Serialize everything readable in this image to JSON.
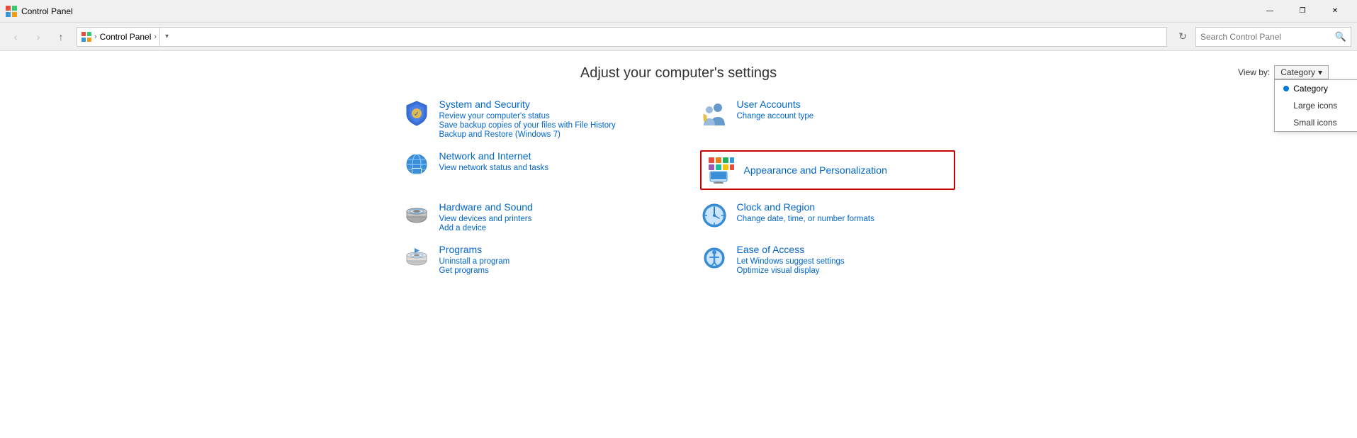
{
  "window": {
    "title": "Control Panel",
    "icon": "control-panel-icon"
  },
  "titlebar": {
    "minimize_label": "—",
    "restore_label": "❐",
    "close_label": "✕"
  },
  "navbar": {
    "back_label": "‹",
    "forward_label": "›",
    "up_label": "↑",
    "address": "Control Panel",
    "breadcrumb_root": "⊞",
    "breadcrumb_sep": "›",
    "refresh_label": "↻",
    "down_label": "▾",
    "search_placeholder": "Search Control Panel",
    "search_icon": "🔍"
  },
  "main": {
    "page_title": "Adjust your computer's settings",
    "viewby_label": "View by:",
    "viewby_current": "Category",
    "viewby_options": [
      {
        "id": "category",
        "label": "Category",
        "selected": true
      },
      {
        "id": "large-icons",
        "label": "Large icons",
        "selected": false
      },
      {
        "id": "small-icons",
        "label": "Small icons",
        "selected": false
      }
    ]
  },
  "categories": [
    {
      "id": "system-security",
      "title": "System and Security",
      "links": [
        "Review your computer's status",
        "Save backup copies of your files with File History",
        "Backup and Restore (Windows 7)"
      ]
    },
    {
      "id": "user-accounts",
      "title": "User Accounts",
      "links": [
        "Change account type"
      ]
    },
    {
      "id": "network-internet",
      "title": "Network and Internet",
      "links": [
        "View network status and tasks"
      ]
    },
    {
      "id": "appearance",
      "title": "Appearance and Personalization",
      "links": [],
      "highlighted": true
    },
    {
      "id": "hardware-sound",
      "title": "Hardware and Sound",
      "links": [
        "View devices and printers",
        "Add a device"
      ]
    },
    {
      "id": "clock-region",
      "title": "Clock and Region",
      "links": [
        "Change date, time, or number formats"
      ]
    },
    {
      "id": "programs",
      "title": "Programs",
      "links": [
        "Uninstall a program",
        "Get programs"
      ]
    },
    {
      "id": "ease-access",
      "title": "Ease of Access",
      "links": [
        "Let Windows suggest settings",
        "Optimize visual display"
      ]
    }
  ]
}
